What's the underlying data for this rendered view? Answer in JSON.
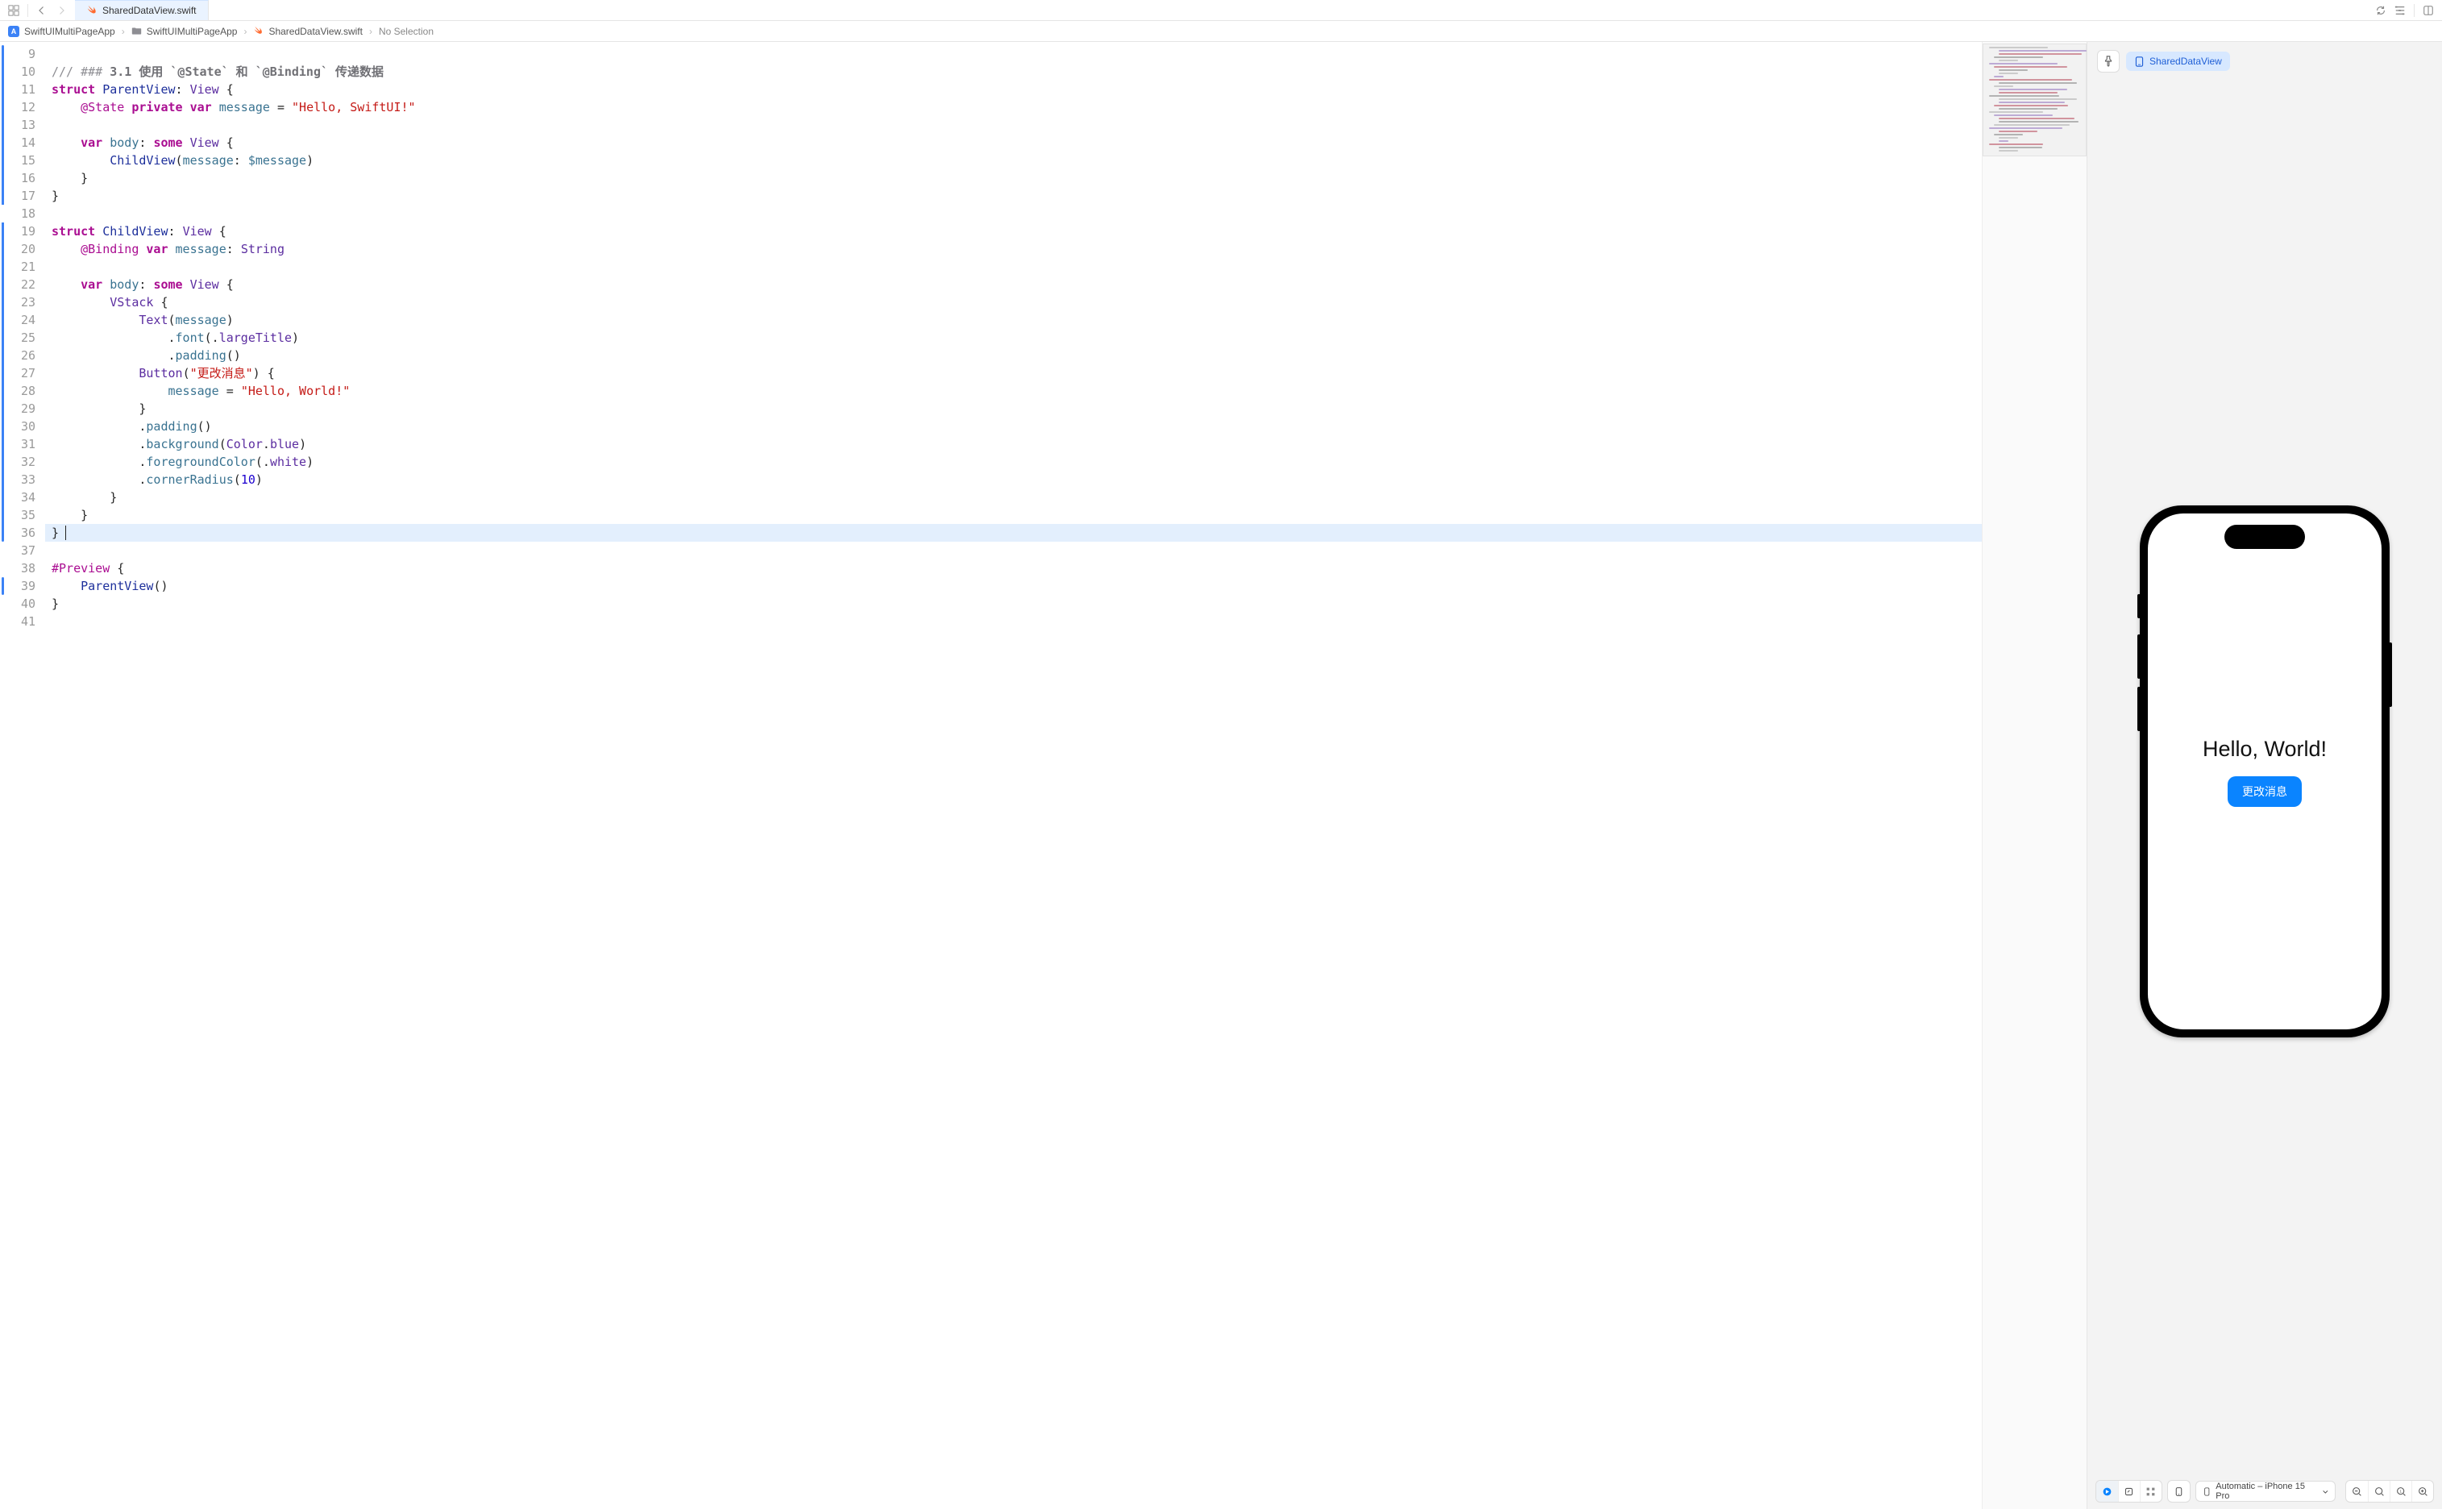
{
  "tab": {
    "title": "SharedDataView.swift"
  },
  "breadcrumb": {
    "app": "SwiftUIMultiPageApp",
    "folder": "SwiftUIMultiPageApp",
    "file": "SharedDataView.swift",
    "selection": "No Selection"
  },
  "editor": {
    "first_line_number": 9,
    "cursor_line": 36,
    "lines": [
      {
        "n": 9,
        "tokens": []
      },
      {
        "n": 10,
        "tokens": [
          [
            "cmt",
            "/// "
          ],
          [
            "cmt",
            "### "
          ],
          [
            "cmt-strong",
            "3.1 使用 `@State` 和 `@Binding` 传递数据"
          ]
        ]
      },
      {
        "n": 11,
        "tokens": [
          [
            "kw",
            "struct"
          ],
          [
            "",
            " "
          ],
          [
            "typ",
            "ParentView"
          ],
          [
            "",
            ": "
          ],
          [
            "typ2",
            "View"
          ],
          [
            "",
            " {"
          ]
        ]
      },
      {
        "n": 12,
        "tokens": [
          [
            "",
            "    "
          ],
          [
            "kw2",
            "@State"
          ],
          [
            "",
            " "
          ],
          [
            "kw",
            "private"
          ],
          [
            "",
            " "
          ],
          [
            "kw",
            "var"
          ],
          [
            "",
            " "
          ],
          [
            "id",
            "message"
          ],
          [
            "",
            " = "
          ],
          [
            "str",
            "\"Hello, SwiftUI!\""
          ]
        ]
      },
      {
        "n": 13,
        "tokens": []
      },
      {
        "n": 14,
        "tokens": [
          [
            "",
            "    "
          ],
          [
            "kw",
            "var"
          ],
          [
            "",
            " "
          ],
          [
            "id",
            "body"
          ],
          [
            "",
            ": "
          ],
          [
            "kw",
            "some"
          ],
          [
            "",
            " "
          ],
          [
            "typ2",
            "View"
          ],
          [
            "",
            " {"
          ]
        ]
      },
      {
        "n": 15,
        "tokens": [
          [
            "",
            "        "
          ],
          [
            "typ",
            "ChildView"
          ],
          [
            "",
            "("
          ],
          [
            "idlb",
            "message"
          ],
          [
            "",
            ": "
          ],
          [
            "id",
            "$message"
          ],
          [
            "",
            ")"
          ]
        ]
      },
      {
        "n": 16,
        "tokens": [
          [
            "",
            "    }"
          ]
        ]
      },
      {
        "n": 17,
        "tokens": [
          [
            "",
            "}"
          ]
        ]
      },
      {
        "n": 18,
        "tokens": []
      },
      {
        "n": 19,
        "tokens": [
          [
            "kw",
            "struct"
          ],
          [
            "",
            " "
          ],
          [
            "typ",
            "ChildView"
          ],
          [
            "",
            ": "
          ],
          [
            "typ2",
            "View"
          ],
          [
            "",
            " {"
          ]
        ]
      },
      {
        "n": 20,
        "tokens": [
          [
            "",
            "    "
          ],
          [
            "kw2",
            "@Binding"
          ],
          [
            "",
            " "
          ],
          [
            "kw",
            "var"
          ],
          [
            "",
            " "
          ],
          [
            "id",
            "message"
          ],
          [
            "",
            ": "
          ],
          [
            "typ2",
            "String"
          ]
        ]
      },
      {
        "n": 21,
        "tokens": []
      },
      {
        "n": 22,
        "tokens": [
          [
            "",
            "    "
          ],
          [
            "kw",
            "var"
          ],
          [
            "",
            " "
          ],
          [
            "id",
            "body"
          ],
          [
            "",
            ": "
          ],
          [
            "kw",
            "some"
          ],
          [
            "",
            " "
          ],
          [
            "typ2",
            "View"
          ],
          [
            "",
            " {"
          ]
        ]
      },
      {
        "n": 23,
        "tokens": [
          [
            "",
            "        "
          ],
          [
            "typ2",
            "VStack"
          ],
          [
            "",
            " {"
          ]
        ]
      },
      {
        "n": 24,
        "tokens": [
          [
            "",
            "            "
          ],
          [
            "typ2",
            "Text"
          ],
          [
            "",
            "("
          ],
          [
            "id",
            "message"
          ],
          [
            "",
            ")"
          ]
        ]
      },
      {
        "n": 25,
        "tokens": [
          [
            "",
            "                ."
          ],
          [
            "fn",
            "font"
          ],
          [
            "",
            "(."
          ],
          [
            "enumv",
            "largeTitle"
          ],
          [
            "",
            ")"
          ]
        ]
      },
      {
        "n": 26,
        "tokens": [
          [
            "",
            "                ."
          ],
          [
            "fn",
            "padding"
          ],
          [
            "",
            "()"
          ]
        ]
      },
      {
        "n": 27,
        "tokens": [
          [
            "",
            "            "
          ],
          [
            "typ2",
            "Button"
          ],
          [
            "",
            "("
          ],
          [
            "str",
            "\"更改消息\""
          ],
          [
            "",
            ") {"
          ]
        ]
      },
      {
        "n": 28,
        "tokens": [
          [
            "",
            "                "
          ],
          [
            "id",
            "message"
          ],
          [
            "",
            " = "
          ],
          [
            "str",
            "\"Hello, World!\""
          ]
        ]
      },
      {
        "n": 29,
        "tokens": [
          [
            "",
            "            }"
          ]
        ]
      },
      {
        "n": 30,
        "tokens": [
          [
            "",
            "            ."
          ],
          [
            "fn",
            "padding"
          ],
          [
            "",
            "()"
          ]
        ]
      },
      {
        "n": 31,
        "tokens": [
          [
            "",
            "            ."
          ],
          [
            "fn",
            "background"
          ],
          [
            "",
            "("
          ],
          [
            "typ2",
            "Color"
          ],
          [
            "",
            "."
          ],
          [
            "enumv",
            "blue"
          ],
          [
            "",
            ")"
          ]
        ]
      },
      {
        "n": 32,
        "tokens": [
          [
            "",
            "            ."
          ],
          [
            "fn",
            "foregroundColor"
          ],
          [
            "",
            "(."
          ],
          [
            "enumv",
            "white"
          ],
          [
            "",
            ")"
          ]
        ]
      },
      {
        "n": 33,
        "tokens": [
          [
            "",
            "            ."
          ],
          [
            "fn",
            "cornerRadius"
          ],
          [
            "",
            "("
          ],
          [
            "num",
            "10"
          ],
          [
            "",
            ")"
          ]
        ]
      },
      {
        "n": 34,
        "tokens": [
          [
            "",
            "        }"
          ]
        ]
      },
      {
        "n": 35,
        "tokens": [
          [
            "",
            "    }"
          ]
        ]
      },
      {
        "n": 36,
        "tokens": [
          [
            "",
            "}"
          ]
        ]
      },
      {
        "n": 37,
        "tokens": []
      },
      {
        "n": 38,
        "tokens": [
          [
            "kw2",
            "#Preview"
          ],
          [
            "",
            " {"
          ]
        ]
      },
      {
        "n": 39,
        "tokens": [
          [
            "",
            "    "
          ],
          [
            "typ",
            "ParentView"
          ],
          [
            "",
            "()"
          ]
        ]
      },
      {
        "n": 40,
        "tokens": [
          [
            "",
            "}"
          ]
        ]
      },
      {
        "n": 41,
        "tokens": []
      }
    ]
  },
  "preview": {
    "chip_label": "SharedDataView",
    "app_title": "Hello, World!",
    "button_label": "更改消息",
    "device_label": "Automatic – iPhone 15 Pro"
  }
}
